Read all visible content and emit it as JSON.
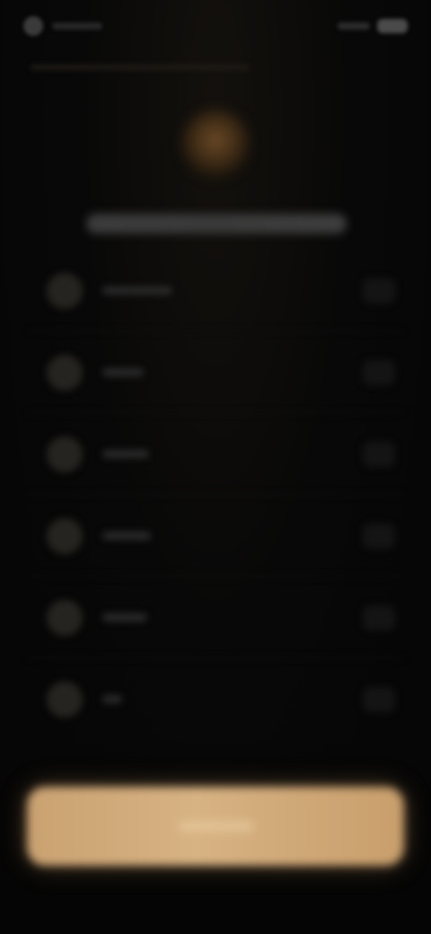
{
  "note_visible_text": "",
  "colors": {
    "background": "#050505",
    "accent": "#d2ab7a",
    "avatar": "#6b4a26"
  },
  "header": {
    "back_icon": "back-icon",
    "status_icon": "battery-icon"
  },
  "list": {
    "items": [
      {
        "icon": "option-icon",
        "label_width": 78
      },
      {
        "icon": "option-icon",
        "label_width": 46
      },
      {
        "icon": "option-icon",
        "label_width": 52
      },
      {
        "icon": "option-icon",
        "label_width": 54
      },
      {
        "icon": "option-icon",
        "label_width": 50
      },
      {
        "icon": "option-icon",
        "label_width": 22
      }
    ]
  },
  "primary_button": {
    "icon": "none"
  }
}
